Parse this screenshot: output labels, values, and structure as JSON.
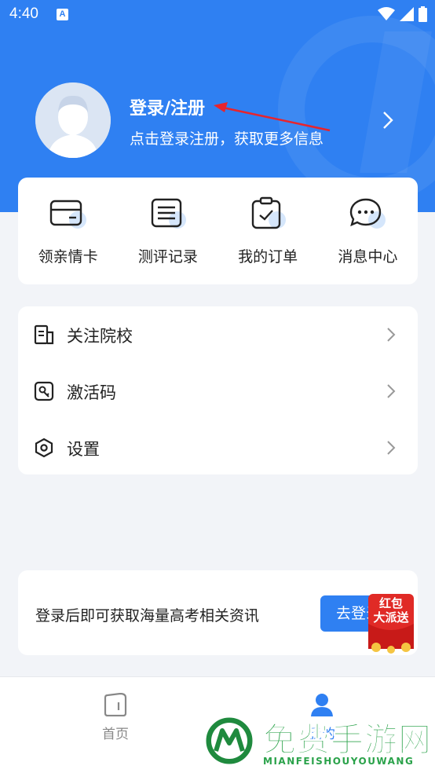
{
  "status_bar": {
    "time": "4:40",
    "notification_icon": "a-icon",
    "icons": [
      "wifi-icon",
      "signal-icon",
      "battery-icon"
    ]
  },
  "header": {
    "login_title": "登录/注册",
    "login_subtitle": "点击登录注册，获取更多信息",
    "avatar_icon": "default-avatar-icon",
    "accent_color": "#2f80f2"
  },
  "quick_actions": [
    {
      "label": "领亲情卡",
      "icon": "card-icon"
    },
    {
      "label": "测评记录",
      "icon": "list-icon"
    },
    {
      "label": "我的订单",
      "icon": "clipboard-check-icon"
    },
    {
      "label": "消息中心",
      "icon": "chat-bubble-icon"
    }
  ],
  "menu": [
    {
      "label": "关注院校",
      "icon": "school-icon"
    },
    {
      "label": "激活码",
      "icon": "activation-code-icon"
    },
    {
      "label": "设置",
      "icon": "settings-hexagon-icon"
    }
  ],
  "promo": {
    "text": "登录后即可获取海量高考相关资讯",
    "button_label": "去登录",
    "badge_line1": "红包",
    "badge_line2": "大派送"
  },
  "tabs": [
    {
      "label": "首页",
      "icon": "home-icon",
      "active": false
    },
    {
      "label": "我的",
      "icon": "user-icon",
      "active": true
    }
  ],
  "watermark": {
    "title": "免费手游网",
    "subtitle": "MIANFEISHOUYOUWANG"
  }
}
